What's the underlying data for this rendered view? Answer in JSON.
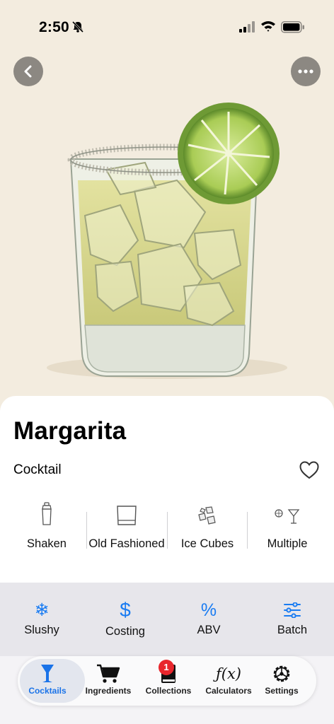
{
  "status_bar": {
    "time": "2:50"
  },
  "drink": {
    "name": "Margarita",
    "category": "Cocktail",
    "properties": [
      {
        "icon": "shaker-icon",
        "label": "Shaken"
      },
      {
        "icon": "old-fashioned-glass-icon",
        "label": "Old Fashioned"
      },
      {
        "icon": "ice-cubes-icon",
        "label": "Ice Cubes"
      },
      {
        "icon": "garnish-martini-icon",
        "label": "Multiple"
      }
    ]
  },
  "tools": [
    {
      "icon": "snowflake-icon",
      "glyph": "❄",
      "label": "Slushy"
    },
    {
      "icon": "dollar-icon",
      "glyph": "$",
      "label": "Costing"
    },
    {
      "icon": "percent-icon",
      "glyph": "%",
      "label": "ABV"
    },
    {
      "icon": "sliders-icon",
      "glyph": "",
      "label": "Batch"
    }
  ],
  "tabs": [
    {
      "icon": "cocktail-glass-icon",
      "label": "Cocktails",
      "active": true
    },
    {
      "icon": "cart-icon",
      "label": "Ingredients"
    },
    {
      "icon": "book-icon",
      "label": "Collections",
      "badge": "1"
    },
    {
      "icon": "function-icon",
      "glyph": "ƒ(x)",
      "label": "Calculators"
    },
    {
      "icon": "gear-icon",
      "label": "Settings"
    }
  ],
  "colors": {
    "accent": "#1a7cf2",
    "badge": "#e8262c",
    "hero_bg": "#f3ecdf"
  }
}
